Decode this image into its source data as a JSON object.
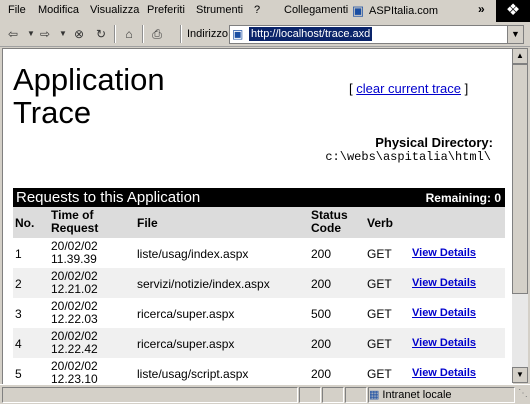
{
  "menubar": {
    "items": [
      "File",
      "Modifica",
      "Visualizza",
      "Preferiti",
      "Strumenti",
      "?"
    ],
    "links_label": "Collegamenti",
    "link_site": "ASPItalia.com"
  },
  "address": {
    "label": "Indirizzo",
    "url": "http://localhost/trace.axd"
  },
  "page": {
    "title": "Application Trace",
    "clear_prefix": "[ ",
    "clear_link": "clear current trace",
    "clear_suffix": " ]",
    "physical_label": "Physical Directory:",
    "physical_value": "c:\\webs\\aspitalia\\html\\",
    "requests_title": "Requests to this Application",
    "remaining": "Remaining: 0"
  },
  "table": {
    "headers": {
      "no": "No.",
      "time": "Time of Request",
      "file": "File",
      "status": "Status Code",
      "verb": "Verb"
    },
    "rows": [
      {
        "no": "1",
        "date": "20/02/02",
        "time": "11.39.39",
        "file": "liste/usag/index.aspx",
        "status": "200",
        "verb": "GET",
        "link": "View Details"
      },
      {
        "no": "2",
        "date": "20/02/02",
        "time": "12.21.02",
        "file": "servizi/notizie/index.aspx",
        "status": "200",
        "verb": "GET",
        "link": "View Details"
      },
      {
        "no": "3",
        "date": "20/02/02",
        "time": "12.22.03",
        "file": "ricerca/super.aspx",
        "status": "500",
        "verb": "GET",
        "link": "View Details"
      },
      {
        "no": "4",
        "date": "20/02/02",
        "time": "12.22.42",
        "file": "ricerca/super.aspx",
        "status": "200",
        "verb": "GET",
        "link": "View Details"
      },
      {
        "no": "5",
        "date": "20/02/02",
        "time": "12.23.10",
        "file": "liste/usag/script.aspx",
        "status": "200",
        "verb": "GET",
        "link": "View Details"
      }
    ]
  },
  "status": {
    "zone": "Intranet locale"
  },
  "icons": [
    "back-icon",
    "forward-icon",
    "stop-icon",
    "refresh-icon",
    "home-icon",
    "print-icon",
    "page-icon",
    "intranet-icon",
    "windows-logo-icon"
  ]
}
